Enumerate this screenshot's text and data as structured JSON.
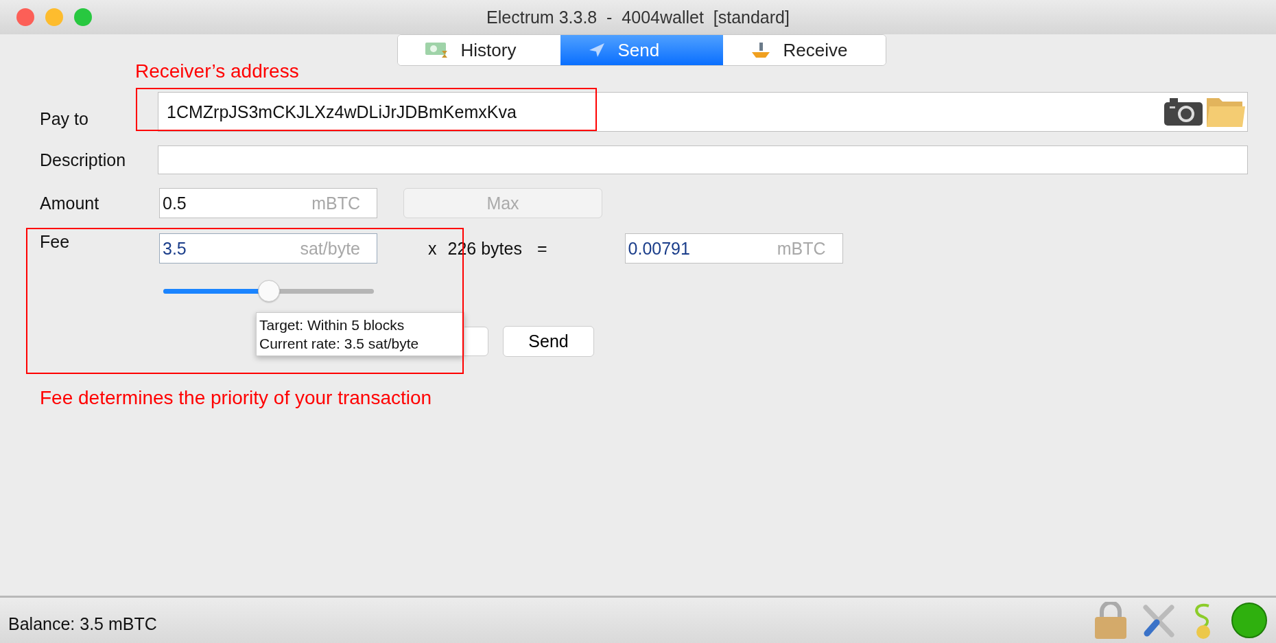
{
  "window": {
    "title": "Electrum 3.3.8  -  4004wallet  [standard]"
  },
  "tabs": [
    {
      "label": "History",
      "selected": false
    },
    {
      "label": "Send",
      "selected": true
    },
    {
      "label": "Receive",
      "selected": false
    }
  ],
  "form": {
    "pay_to": {
      "label": "Pay to",
      "value": "1CMZrpJS3mCKJLXz4wDLiJrJDBmKemxKva"
    },
    "description": {
      "label": "Description"
    },
    "amount": {
      "label": "Amount",
      "value": "0.5",
      "unit": "mBTC",
      "max_button": "Max"
    },
    "fee": {
      "label": "Fee",
      "rate": "3.5",
      "rate_unit": "sat/byte",
      "times": "x",
      "size": "226 bytes",
      "equals": "=",
      "total": "0.00791",
      "total_unit": "mBTC",
      "slider": {
        "level": 0.5
      }
    },
    "send_button": "Send",
    "tooltip": [
      "Target: Within 5 blocks",
      "Current rate: 3.5 sat/byte"
    ]
  },
  "annotations": [
    {
      "text": "Receiver’s address"
    },
    {
      "text": "Fee determines the priority of your transaction"
    }
  ],
  "status_bar": {
    "balance": "Balance: 3.5 mBTC"
  }
}
